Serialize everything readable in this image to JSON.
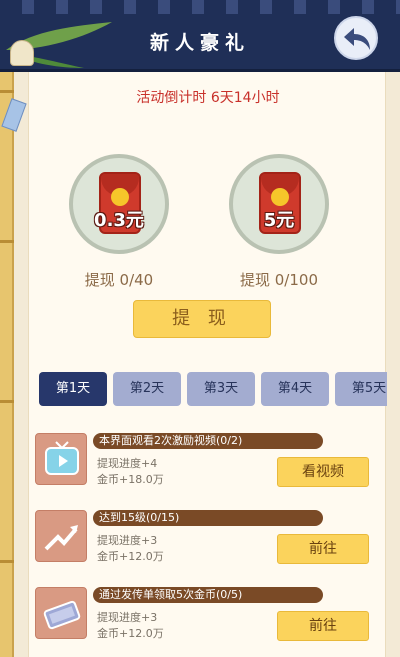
{
  "header": {
    "title": "新人豪礼"
  },
  "countdown": "活动倒计时 6天14小时",
  "rewards": [
    {
      "amount": "0.3元",
      "progress": "提现 0/40"
    },
    {
      "amount": "5元",
      "progress": "提现 0/100"
    }
  ],
  "withdraw_label": "提 现",
  "tabs": [
    "第1天",
    "第2天",
    "第3天",
    "第4天",
    "第5天"
  ],
  "active_tab": "第1天",
  "tasks": [
    {
      "title": "本界面观看2次激励视频(0/2)",
      "progress": "提现进度+4",
      "coins": "金币+18.0万",
      "button": "看视频",
      "icon": "tv-icon"
    },
    {
      "title": "达到15级(0/15)",
      "progress": "提现进度+3",
      "coins": "金币+12.0万",
      "button": "前往",
      "icon": "trend-up-icon"
    },
    {
      "title": "通过发传单领取5次金币(0/5)",
      "progress": "提现进度+3",
      "coins": "金币+12.0万",
      "button": "前往",
      "icon": "flyer-icon"
    }
  ],
  "colors": {
    "header": "#1f2f57",
    "accent_red": "#c8302a",
    "button_yellow": "#fbd35c",
    "tab_active": "#27376b"
  }
}
